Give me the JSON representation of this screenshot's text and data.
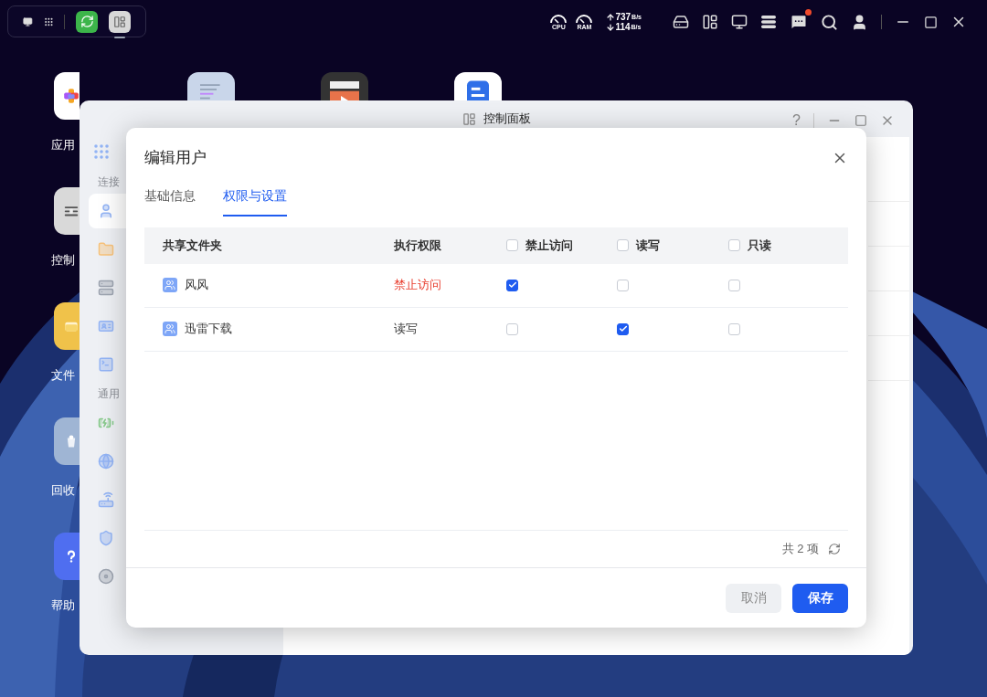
{
  "taskbar": {
    "apps": [
      {
        "kind": "sync",
        "selected": false
      },
      {
        "kind": "control",
        "selected": true
      }
    ]
  },
  "status": {
    "gauges": [
      "CPU",
      "RAM"
    ],
    "upload": "737",
    "upload_unit": "B/s",
    "download": "114",
    "download_unit": "B/s",
    "notifications": true
  },
  "desktop": {
    "column": [
      {
        "kind": "apps",
        "label": "应用"
      },
      {
        "kind": "control",
        "label": "控制"
      },
      {
        "kind": "files",
        "label": "文件"
      },
      {
        "kind": "trash",
        "label": "回收"
      },
      {
        "kind": "help",
        "label": "帮助"
      }
    ],
    "row": [
      {
        "kind": "code"
      },
      {
        "kind": "video"
      },
      {
        "kind": "docs"
      }
    ]
  },
  "window": {
    "title": "控制面板",
    "help": "?"
  },
  "sidebar": {
    "sections": [
      {
        "label": "连接",
        "items": [
          {
            "kind": "user",
            "selected": true
          },
          {
            "kind": "folder",
            "selected": false
          },
          {
            "kind": "storage",
            "selected": false
          },
          {
            "kind": "card",
            "selected": false
          },
          {
            "kind": "terminal",
            "selected": false
          }
        ]
      },
      {
        "label": "通用",
        "items": [
          {
            "kind": "battery",
            "selected": false
          },
          {
            "kind": "globe",
            "selected": false
          },
          {
            "kind": "router",
            "selected": false
          },
          {
            "kind": "shield",
            "selected": false
          },
          {
            "kind": "disk",
            "selected": false
          }
        ]
      }
    ]
  },
  "dialog": {
    "title": "编辑用户",
    "tabs": [
      {
        "label": "基础信息",
        "selected": false
      },
      {
        "label": "权限与设置",
        "selected": true
      }
    ],
    "table": {
      "columns": [
        {
          "label": "共享文件夹"
        },
        {
          "label": "执行权限"
        },
        {
          "label": "禁止访问",
          "checked": false
        },
        {
          "label": "读写",
          "checked": false
        },
        {
          "label": "只读",
          "checked": false
        }
      ],
      "rows": [
        {
          "folder": "风风",
          "permission": "禁止访问",
          "kind": "deny",
          "checks": [
            true,
            false,
            false
          ]
        },
        {
          "folder": "迅雷下载",
          "permission": "读写",
          "kind": "allow",
          "checks": [
            false,
            true,
            false
          ]
        }
      ]
    },
    "count": "共 2 项",
    "buttons": [
      {
        "label": "取消",
        "kind": "secondary"
      },
      {
        "label": "保存",
        "kind": "primary"
      }
    ]
  }
}
